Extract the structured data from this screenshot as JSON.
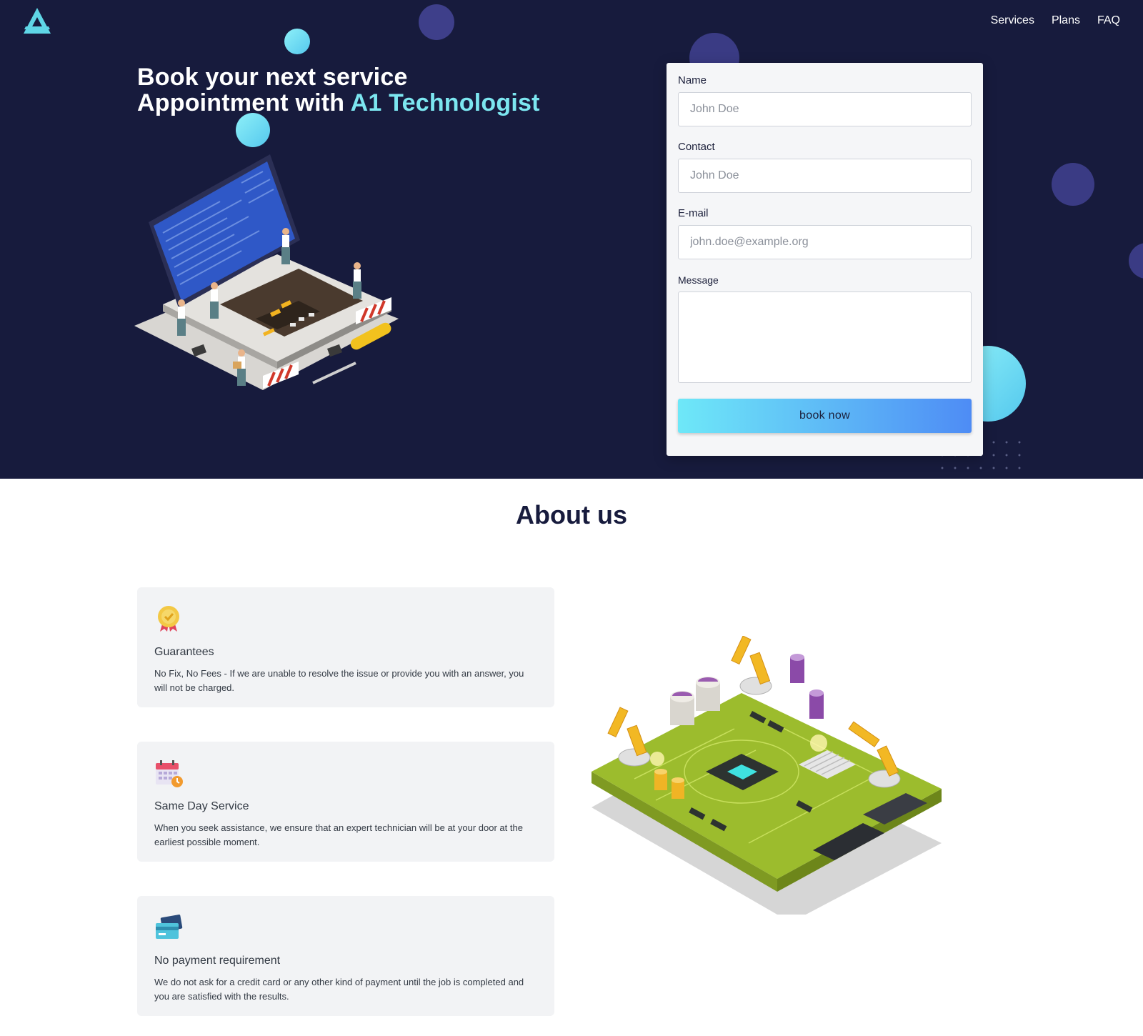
{
  "nav": {
    "logo_icon": "a1-triangle-logo",
    "links": [
      "Services",
      "Plans",
      "FAQ"
    ]
  },
  "hero": {
    "headline_line1": "Book your next service",
    "headline_line2_prefix": "Appointment with ",
    "headline_accent": "A1 Technologist",
    "illustration": "laptop-repair-technicians-illustration"
  },
  "form": {
    "name_label": "Name",
    "name_placeholder": "John Doe",
    "contact_label": "Contact",
    "contact_placeholder": "John Doe",
    "email_label": "E-mail",
    "email_placeholder": "john.doe@example.org",
    "message_label": "Message",
    "message_placeholder": "",
    "submit_label": "book now"
  },
  "about": {
    "title": "About us",
    "cards": [
      {
        "icon": "badge-check-icon",
        "title": "Guarantees",
        "text": "No Fix, No Fees - If we are unable to resolve the issue or provide you with an answer, you will not be charged."
      },
      {
        "icon": "calendar-clock-icon",
        "title": "Same Day Service",
        "text": "When you seek assistance, we ensure that an expert technician will be at your door at the earliest possible moment."
      },
      {
        "icon": "credit-card-icon",
        "title": "No payment requirement",
        "text": "We do not ask for a credit card or any other kind of payment until the job is completed and you are satisfied with the results."
      }
    ],
    "illustration": "circuit-board-robot-arms-illustration"
  },
  "colors": {
    "hero_bg": "#171b3d",
    "accent": "#7ce6f0",
    "button_gradient_start": "#6ee8f8",
    "button_gradient_end": "#4e8cf5",
    "card_bg": "#f2f3f5",
    "bubble_purple": "#3d3f86"
  }
}
